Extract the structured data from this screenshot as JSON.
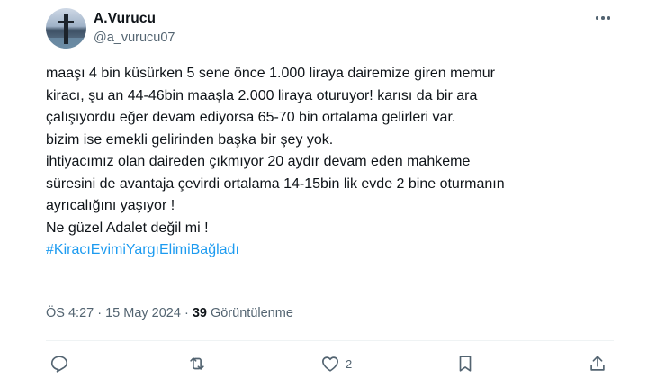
{
  "author": {
    "name": "A.Vurucu",
    "handle": "@a_vurucu07"
  },
  "tweet": {
    "lines": [
      "maaşı 4 bin küsürken 5 sene önce 1.000 liraya dairemize giren memur",
      "kiracı, şu an 44-46bin maaşla 2.000 liraya oturuyor! karısı da bir ara",
      "çalışıyordu eğer devam ediyorsa  65-70 bin ortalama gelirleri var.",
      "bizim ise emekli gelirinden başka bir şey yok.",
      "ihtiyacımız olan daireden çıkmıyor 20 aydır devam eden mahkeme",
      "süresini de avantaja çevirdi ortalama 14-15bin lik evde 2 bine oturmanın",
      "ayrıcalığını yaşıyor !",
      "Ne güzel Adalet değil mi !"
    ],
    "hashtag": "#KiracıEvimiYargıElimiBağladı"
  },
  "meta": {
    "time": "ÖS 4:27",
    "separator": " · ",
    "date": "15 May 2024",
    "views_count": "39",
    "views_label": " Görüntülenme"
  },
  "actions": {
    "like_count": "2"
  },
  "icons": [
    "more-options-icon",
    "reply-icon",
    "retweet-icon",
    "like-icon",
    "bookmark-icon",
    "share-icon"
  ],
  "colors": {
    "text": "#0f1419",
    "secondary": "#536471",
    "link": "#1d9bf0"
  }
}
